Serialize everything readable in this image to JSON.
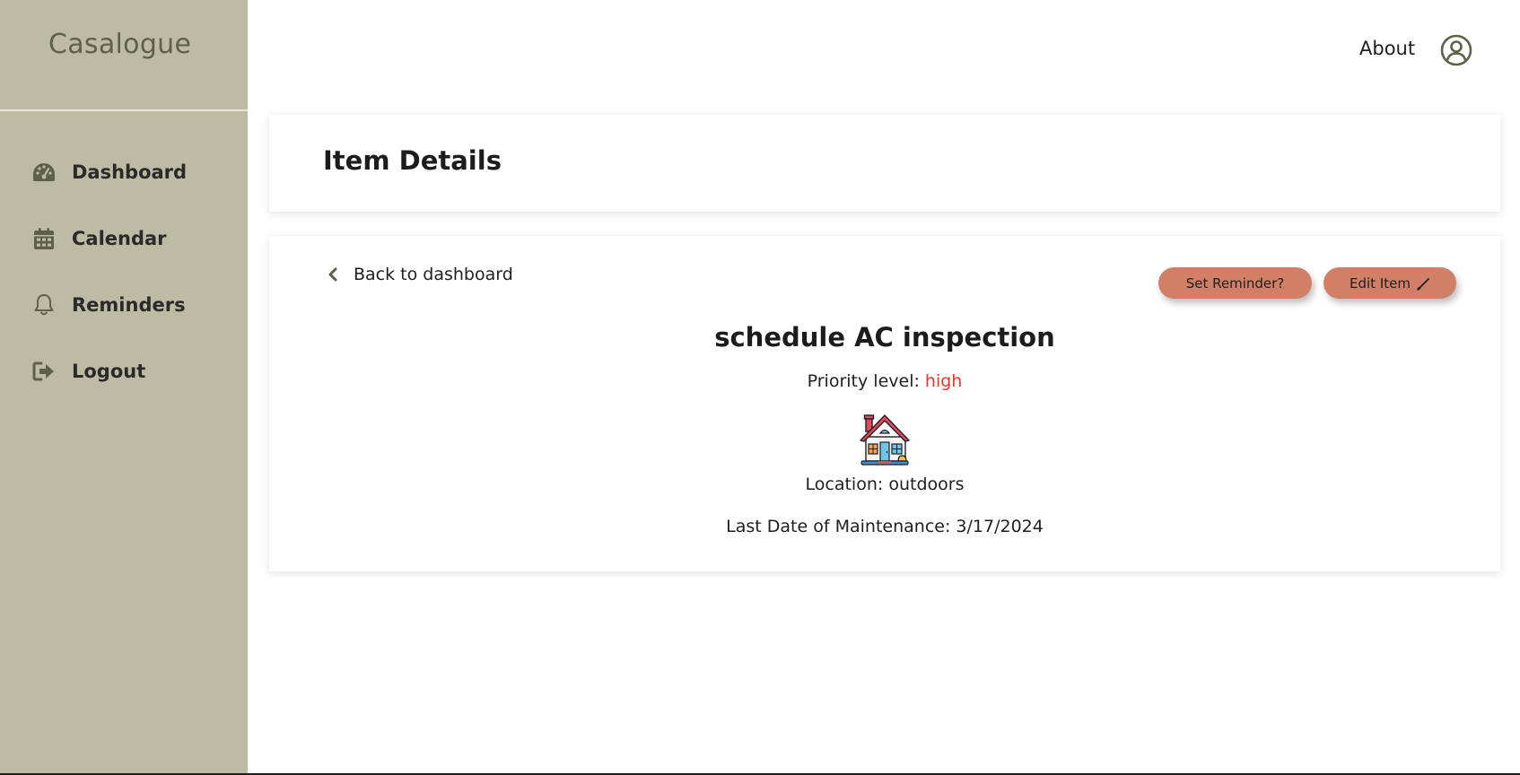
{
  "brand": {
    "name": "Casalogue"
  },
  "sidebar": {
    "items": [
      {
        "label": "Dashboard",
        "icon": "dashboard-gauge-icon"
      },
      {
        "label": "Calendar",
        "icon": "calendar-icon"
      },
      {
        "label": "Reminders",
        "icon": "bell-icon"
      },
      {
        "label": "Logout",
        "icon": "logout-icon"
      }
    ]
  },
  "topbar": {
    "about_label": "About",
    "user_icon": "user-circle-icon"
  },
  "header": {
    "title": "Item Details"
  },
  "details": {
    "back_label": "Back to dashboard",
    "set_reminder_label": "Set Reminder?",
    "edit_label": "Edit Item",
    "item_title": "schedule AC inspection",
    "priority_label": "Priority level:",
    "priority_value": "high",
    "location_label": "Location:",
    "location_value": "outdoors",
    "maintenance_label": "Last Date of Maintenance:",
    "maintenance_value": "3/17/2024",
    "image_icon": "house-icon"
  },
  "colors": {
    "sidebar_bg": "#bebba4",
    "brand_text": "#5e6148",
    "icon": "#5e6148",
    "button_bg": "#d17f66",
    "priority_high": "#e53a2a"
  }
}
